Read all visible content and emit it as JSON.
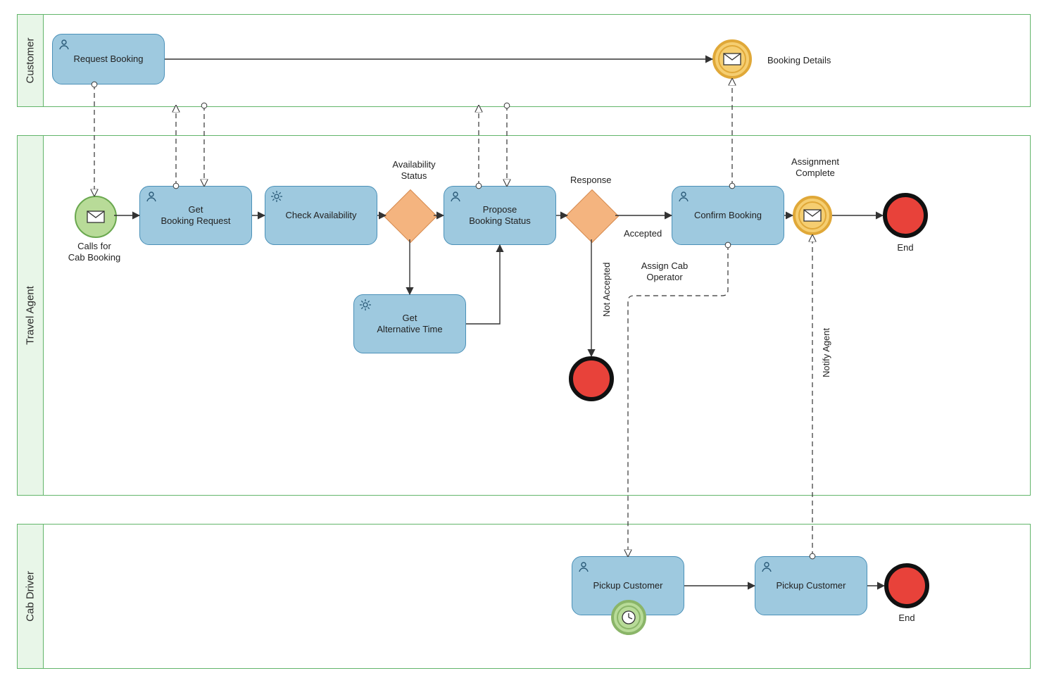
{
  "lanes": {
    "customer": "Customer",
    "agent": "Travel Agent",
    "driver": "Cab Driver"
  },
  "tasks": {
    "request_booking": "Request Booking",
    "get_booking_request": "Get\nBooking Request",
    "check_availability": "Check Availability",
    "propose_booking_status": "Propose\nBooking Status",
    "get_alt_time": "Get\nAlternative Time",
    "confirm_booking": "Confirm Booking",
    "pickup_customer_1": "Pickup Customer",
    "pickup_customer_2": "Pickup Customer"
  },
  "events": {
    "calls_for_cab": "Calls for\nCab Booking",
    "booking_details": "Booking Details",
    "assignment_complete": "Assignment\nComplete",
    "end1": "End",
    "end2": "End"
  },
  "labels": {
    "availability_status": "Availability\nStatus",
    "response": "Response",
    "accepted": "Accepted",
    "not_accepted": "Not Accepted",
    "assign_cab_operator": "Assign Cab\nOperator",
    "notify_agent": "Notify Agent"
  },
  "colors": {
    "task_fill": "#9ec9df",
    "task_border": "#4a90b8",
    "gateway_fill": "#f4b47f",
    "start_fill": "#b8db98",
    "inter_fill": "#f5ce71",
    "end_fill": "#e8423a",
    "pool_border": "#62b56a",
    "pool_title_bg": "#e8f6e8"
  }
}
